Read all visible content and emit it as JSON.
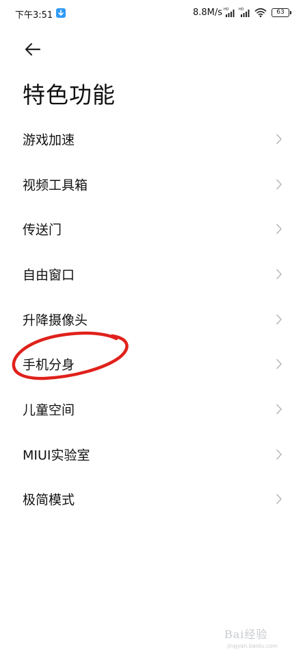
{
  "status_bar": {
    "time": "下午3:51",
    "network_speed": "8.8M/s",
    "battery_level": "63",
    "icons": [
      "app-notification-icon",
      "signal-hd-icon",
      "signal-hd-icon",
      "wifi-icon",
      "battery-icon"
    ]
  },
  "header": {
    "back_icon": "arrow-left-icon",
    "title": "特色功能"
  },
  "menu": {
    "items": [
      {
        "label": "游戏加速"
      },
      {
        "label": "视频工具箱"
      },
      {
        "label": "传送门"
      },
      {
        "label": "自由窗口"
      },
      {
        "label": "升降摄像头"
      },
      {
        "label": "手机分身"
      },
      {
        "label": "儿童空间"
      },
      {
        "label": "MIUI实验室"
      },
      {
        "label": "极简模式"
      }
    ],
    "chevron_icon": "chevron-right-icon"
  },
  "annotation": {
    "highlighted_item": "手机分身",
    "color": "#e0211b"
  },
  "watermark": {
    "brand": "Bai经验",
    "url": "jingyan.baidu.com"
  },
  "colors": {
    "background": "#ffffff",
    "text": "#111111",
    "chevron": "#b8b8b8",
    "accent_app_icon": "#2f9bf5"
  }
}
